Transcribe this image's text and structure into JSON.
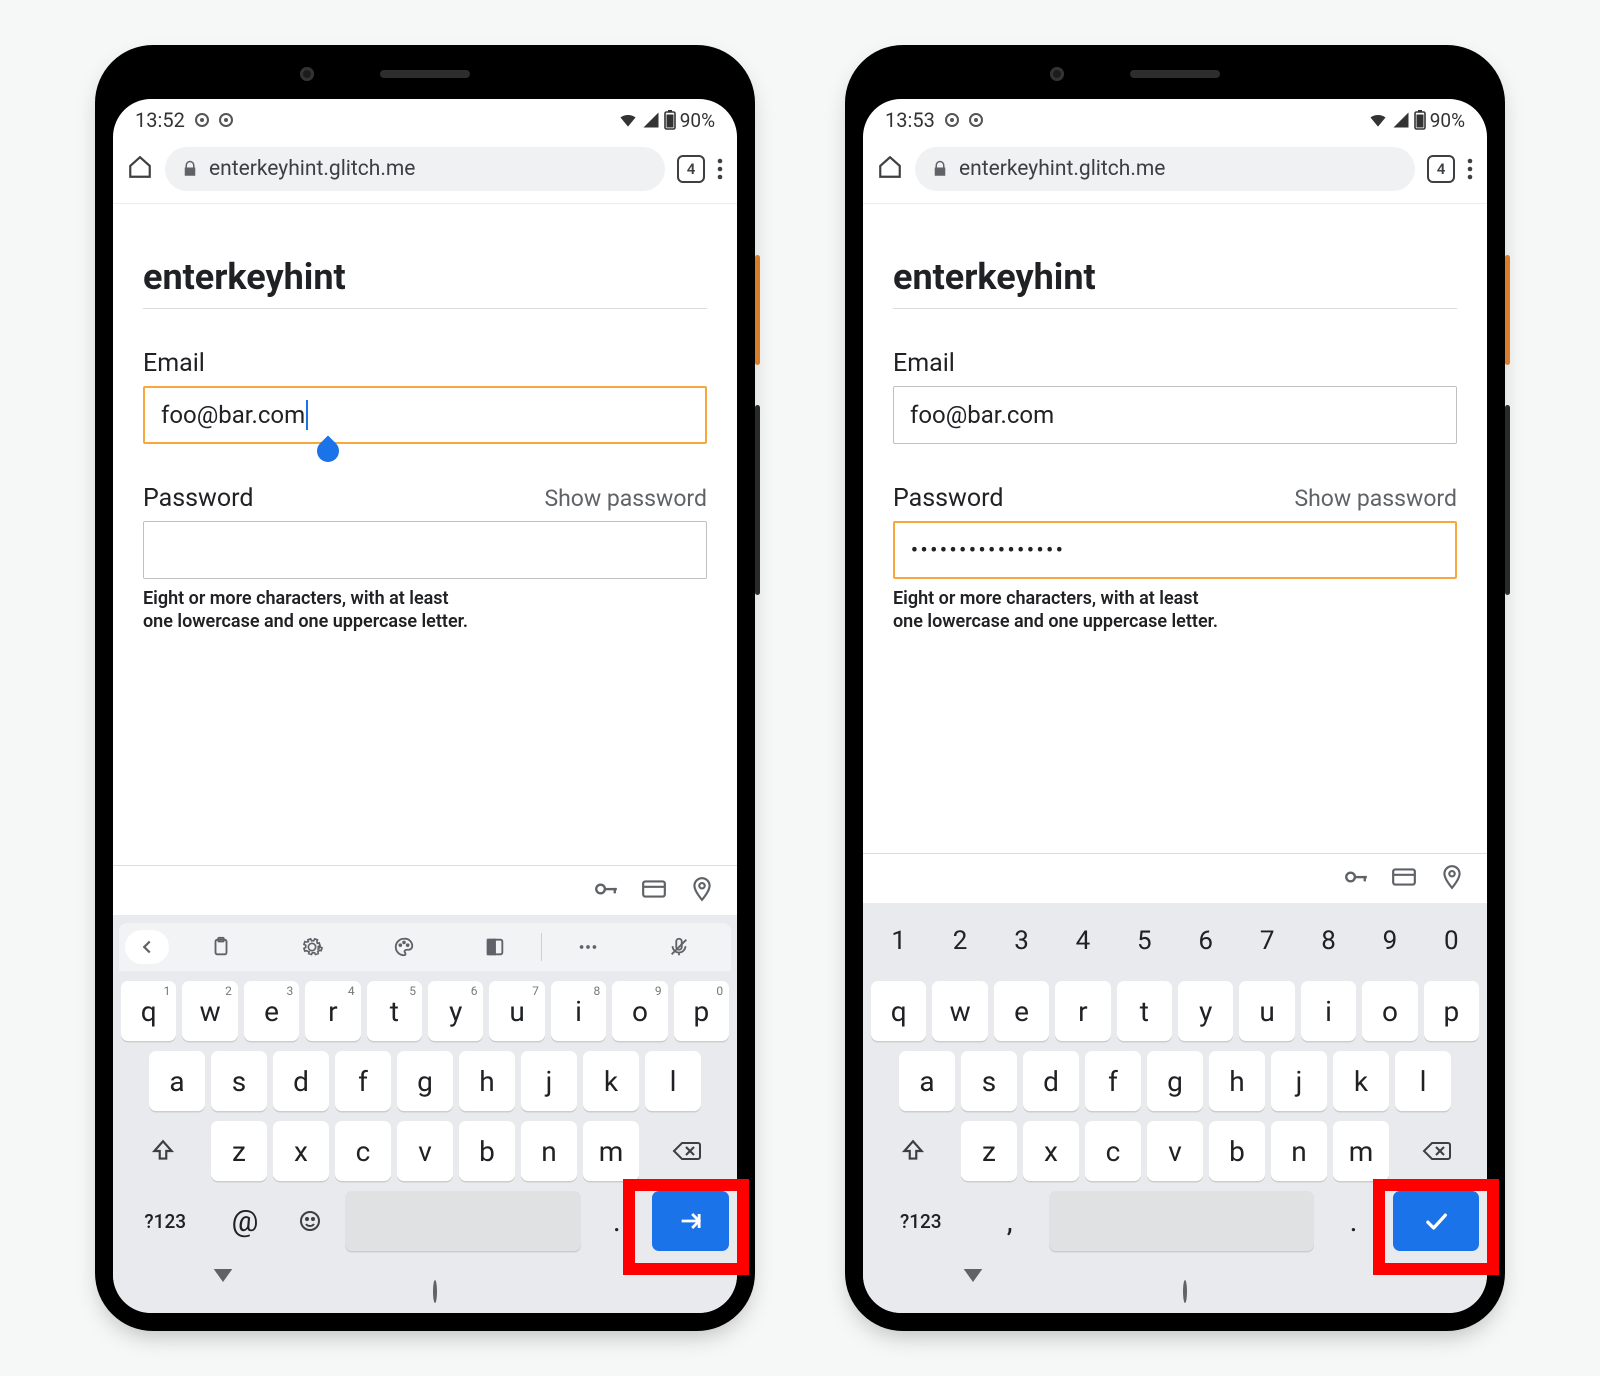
{
  "phones": [
    {
      "status": {
        "time": "13:52",
        "battery": "90%"
      },
      "omnibox": {
        "url": "enterkeyhint.glitch.me",
        "tab_count": "4"
      },
      "page": {
        "heading": "enterkeyhint",
        "email": {
          "label": "Email",
          "value": "foo@bar.com",
          "focused": true
        },
        "password": {
          "label": "Password",
          "toggle": "Show password",
          "value": "",
          "focused": false
        },
        "hint_line1": "Eight or more characters, with at least",
        "hint_line2": "one lowercase and one uppercase letter."
      },
      "keyboard": {
        "variant": "email",
        "toolbar": [
          "collapse",
          "clipboard",
          "gear",
          "palette",
          "onehanded",
          "|",
          "more",
          "mic"
        ],
        "row1": [
          {
            "k": "q",
            "s": "1"
          },
          {
            "k": "w",
            "s": "2"
          },
          {
            "k": "e",
            "s": "3"
          },
          {
            "k": "r",
            "s": "4"
          },
          {
            "k": "t",
            "s": "5"
          },
          {
            "k": "y",
            "s": "6"
          },
          {
            "k": "u",
            "s": "7"
          },
          {
            "k": "i",
            "s": "8"
          },
          {
            "k": "o",
            "s": "9"
          },
          {
            "k": "p",
            "s": "0"
          }
        ],
        "row2": [
          "a",
          "s",
          "d",
          "f",
          "g",
          "h",
          "j",
          "k",
          "l"
        ],
        "row3": [
          "shift",
          "z",
          "x",
          "c",
          "v",
          "b",
          "n",
          "m",
          "backspace"
        ],
        "row4": {
          "sym_label": "?123",
          "extra1": "@",
          "emoji": true,
          "period": ".",
          "enter_icon": "next"
        }
      }
    },
    {
      "status": {
        "time": "13:53",
        "battery": "90%"
      },
      "omnibox": {
        "url": "enterkeyhint.glitch.me",
        "tab_count": "4"
      },
      "page": {
        "heading": "enterkeyhint",
        "email": {
          "label": "Email",
          "value": "foo@bar.com",
          "focused": false
        },
        "password": {
          "label": "Password",
          "toggle": "Show password",
          "value": "••••••••••••••••",
          "focused": true
        },
        "hint_line1": "Eight or more characters, with at least",
        "hint_line2": "one lowercase and one uppercase letter."
      },
      "keyboard": {
        "variant": "password",
        "numrow": [
          "1",
          "2",
          "3",
          "4",
          "5",
          "6",
          "7",
          "8",
          "9",
          "0"
        ],
        "row1": [
          {
            "k": "q"
          },
          {
            "k": "w"
          },
          {
            "k": "e"
          },
          {
            "k": "r"
          },
          {
            "k": "t"
          },
          {
            "k": "y"
          },
          {
            "k": "u"
          },
          {
            "k": "i"
          },
          {
            "k": "o"
          },
          {
            "k": "p"
          }
        ],
        "row2": [
          "a",
          "s",
          "d",
          "f",
          "g",
          "h",
          "j",
          "k",
          "l"
        ],
        "row3": [
          "shift",
          "z",
          "x",
          "c",
          "v",
          "b",
          "n",
          "m",
          "backspace"
        ],
        "row4": {
          "sym_label": "?123",
          "extra1": ",",
          "emoji": false,
          "period": ".",
          "enter_icon": "done"
        }
      }
    }
  ]
}
